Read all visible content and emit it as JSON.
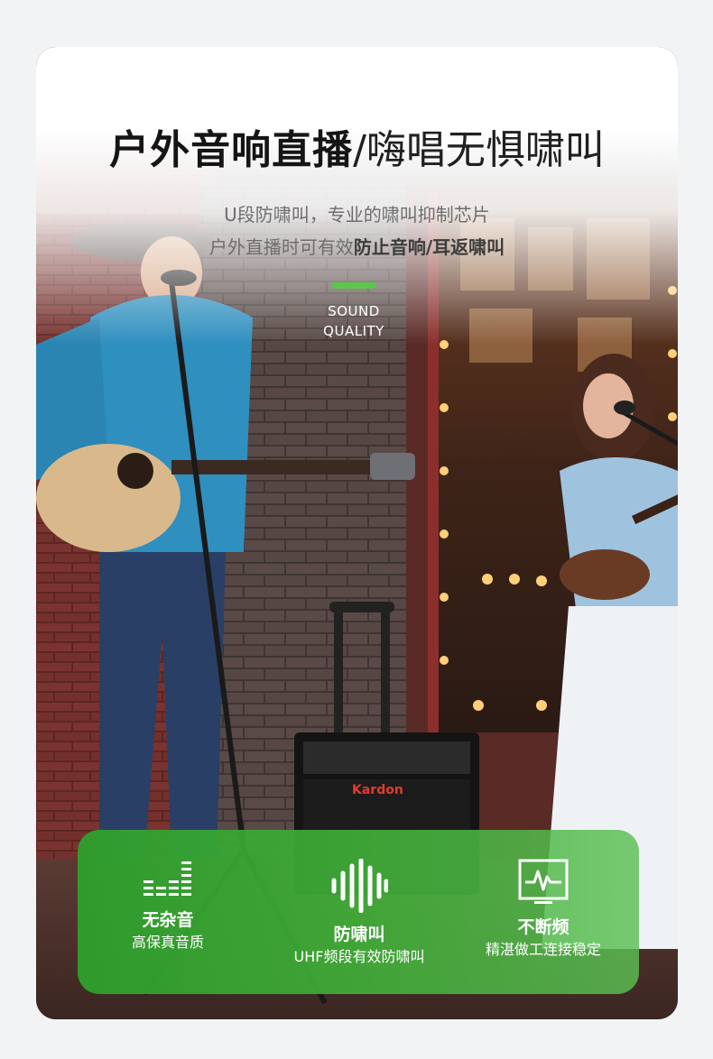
{
  "header": {
    "title_bold": "户外音响直播",
    "title_light": "/嗨唱无惧啸叫",
    "subtitle_line1": "U段防啸叫，专业的啸叫抑制芯片",
    "subtitle_line2_prefix": "户外直播时可有效",
    "subtitle_line2_emphasis": "防止音响/耳返啸叫"
  },
  "badge": {
    "line1": "SOUND",
    "line2": "QUALITY",
    "accent_color": "#5dc64a"
  },
  "amplifier": {
    "brand_text": "Kardon"
  },
  "features": [
    {
      "icon": "equalizer-icon",
      "title": "无杂音",
      "desc": "高保真音质"
    },
    {
      "icon": "sound-wave-icon",
      "title": "防啸叫",
      "desc": "UHF频段有效防啸叫"
    },
    {
      "icon": "waveform-monitor-icon",
      "title": "不断频",
      "desc": "精湛做工连接稳定"
    }
  ],
  "colors": {
    "panel_green": "#34a634",
    "title_text": "#151515",
    "subtitle_text": "#6e6e6e"
  }
}
